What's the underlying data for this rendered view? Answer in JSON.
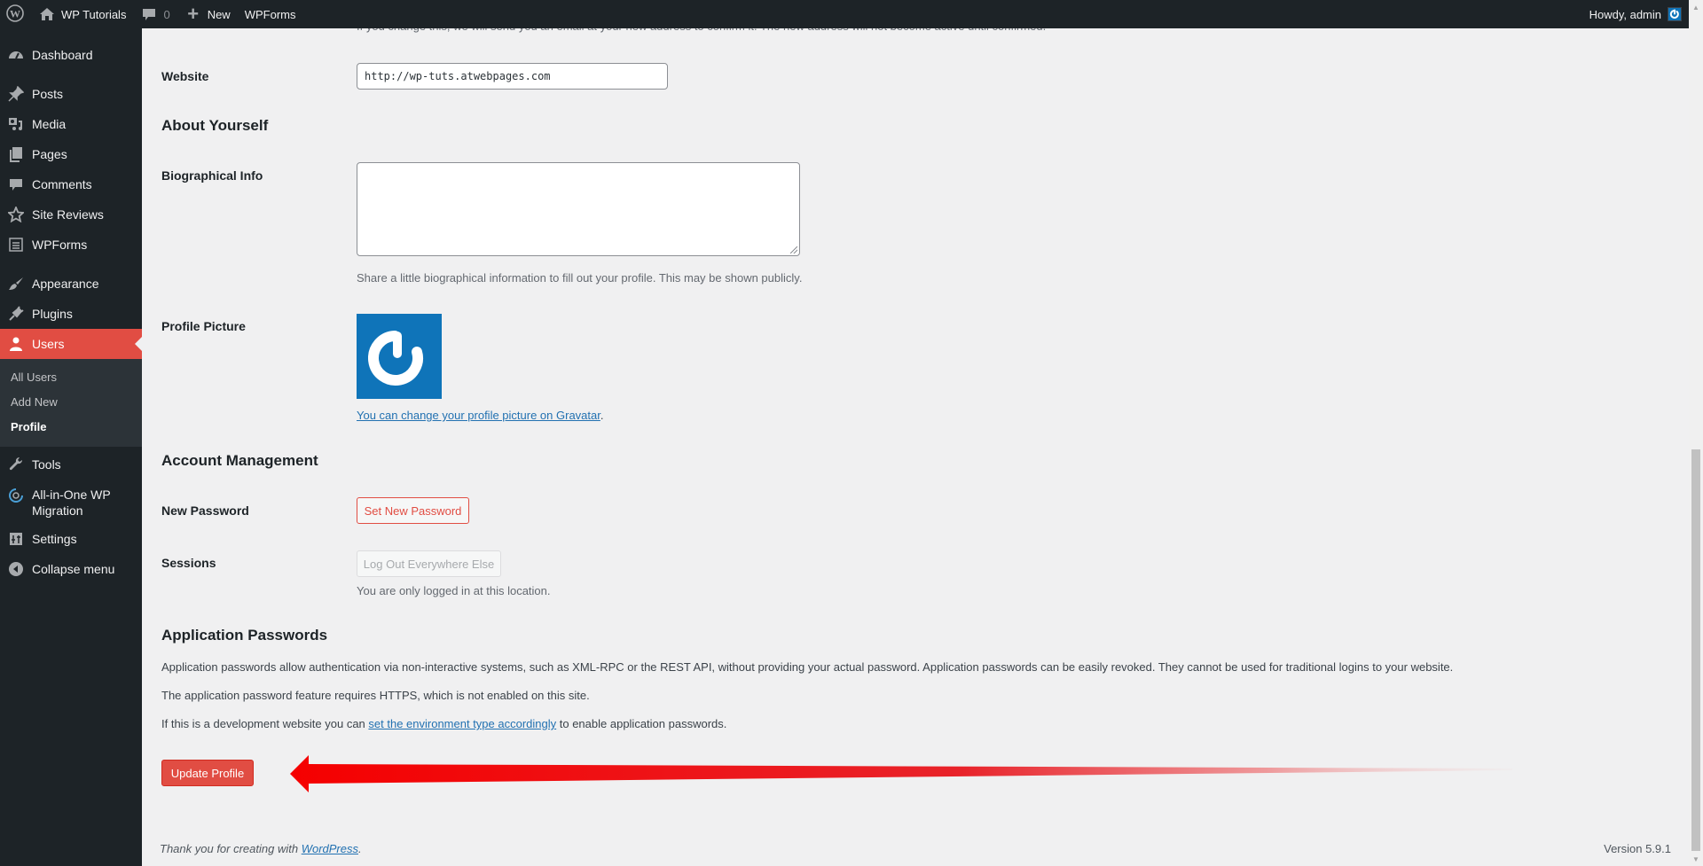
{
  "adminbar": {
    "site_name": "WP Tutorials",
    "comments_count": "0",
    "new_label": "New",
    "wpforms_label": "WPForms",
    "howdy": "Howdy, admin"
  },
  "sidebar": {
    "items": [
      {
        "label": "Dashboard",
        "icon": "dashboard-icon"
      },
      {
        "label": "Posts",
        "icon": "pin-icon"
      },
      {
        "label": "Media",
        "icon": "media-icon"
      },
      {
        "label": "Pages",
        "icon": "pages-icon"
      },
      {
        "label": "Comments",
        "icon": "comment-icon"
      },
      {
        "label": "Site Reviews",
        "icon": "star-icon"
      },
      {
        "label": "WPForms",
        "icon": "form-icon"
      },
      {
        "label": "Appearance",
        "icon": "brush-icon"
      },
      {
        "label": "Plugins",
        "icon": "plug-icon"
      },
      {
        "label": "Users",
        "icon": "user-icon"
      },
      {
        "label": "Tools",
        "icon": "wrench-icon"
      },
      {
        "label": "All-in-One WP Migration",
        "icon": "migration-icon"
      },
      {
        "label": "Settings",
        "icon": "settings-icon"
      },
      {
        "label": "Collapse menu",
        "icon": "collapse-icon"
      }
    ],
    "users_submenu": [
      "All Users",
      "Add New",
      "Profile"
    ]
  },
  "content": {
    "email_notice": "If you change this, we will send you an email at your new address to confirm it. The new address will not become active until confirmed.",
    "website_label": "Website",
    "website_value": "http://wp-tuts.atwebpages.com",
    "about_heading": "About Yourself",
    "bio_label": "Biographical Info",
    "bio_value": "",
    "bio_desc": "Share a little biographical information to fill out your profile. This may be shown publicly.",
    "picture_label": "Profile Picture",
    "gravatar_link": "You can change your profile picture on Gravatar",
    "account_heading": "Account Management",
    "new_password_label": "New Password",
    "set_password_button": "Set New Password",
    "sessions_label": "Sessions",
    "logout_button": "Log Out Everywhere Else",
    "sessions_desc": "You are only logged in at this location.",
    "app_pw_heading": "Application Passwords",
    "app_pw_desc1": "Application passwords allow authentication via non-interactive systems, such as XML-RPC or the REST API, without providing your actual password. Application passwords can be easily revoked. They cannot be used for traditional logins to your website.",
    "app_pw_desc2": "The application password feature requires HTTPS, which is not enabled on this site.",
    "app_pw_desc3_pre": "If this is a development website you can ",
    "app_pw_desc3_link": "set the environment type accordingly",
    "app_pw_desc3_post": " to enable application passwords.",
    "update_button": "Update Profile"
  },
  "footer": {
    "thanks_pre": "Thank you for creating with ",
    "thanks_link": "WordPress",
    "thanks_post": ".",
    "version": "Version 5.9.1"
  },
  "colors": {
    "accent": "#e14d43",
    "admin_bar": "#1d2327",
    "link": "#2271b1",
    "avatar_bg": "#0f74b9"
  }
}
